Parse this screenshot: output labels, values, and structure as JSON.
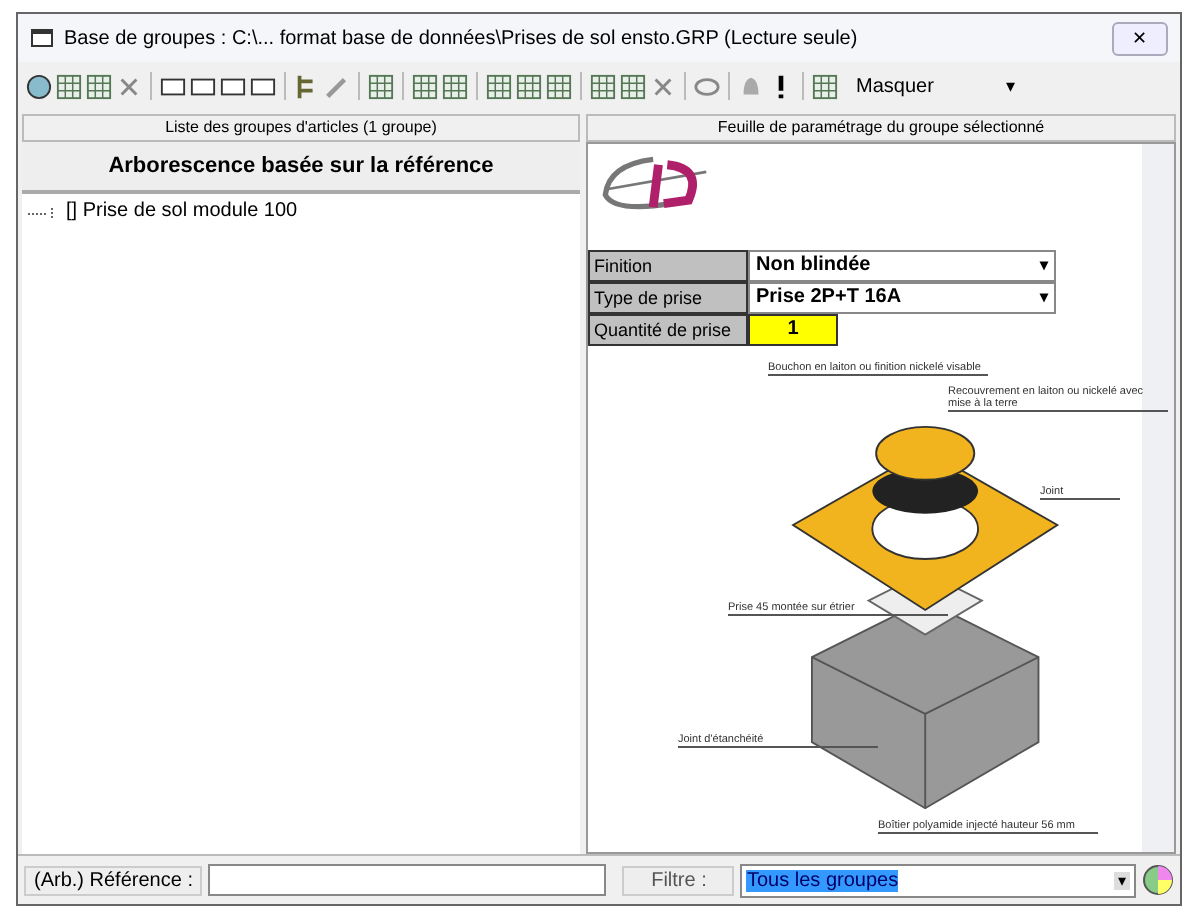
{
  "window": {
    "title": "Base de groupes : C:\\... format base de données\\Prises de sol ensto.GRP (Lecture seule)",
    "close": "✕"
  },
  "toolbar": {
    "mode": "Masquer",
    "caret": "▾"
  },
  "left_panel": {
    "header": "Liste des groupes d'articles (1 groupe)",
    "tree_header": "Arborescence basée sur la référence",
    "tree": [
      {
        "label": "[] Prise de sol module 100",
        "selected": false
      }
    ]
  },
  "right_panel": {
    "header": "Feuille de paramétrage du groupe sélectionné",
    "params": [
      {
        "label": "Finition",
        "kind": "select",
        "value": "Non blindée"
      },
      {
        "label": "Type de prise",
        "kind": "select",
        "value": "Prise 2P+T 16A"
      },
      {
        "label": "Quantité de prise",
        "kind": "number",
        "value": "1"
      }
    ],
    "diagram_labels": [
      "Bouchon en laiton ou finition nickelé visable",
      "Recouvrement en laiton ou nickelé avec mise à la terre",
      "Joint",
      "Prise 45 montée sur étrier",
      "Joint d'étanchéité",
      "Boîtier polyamide injecté hauteur 56 mm"
    ]
  },
  "bottom_bar": {
    "reference_label": "(Arb.) Référence :",
    "filter_label": "Filtre :",
    "filter_value": "Tous les groupes"
  }
}
